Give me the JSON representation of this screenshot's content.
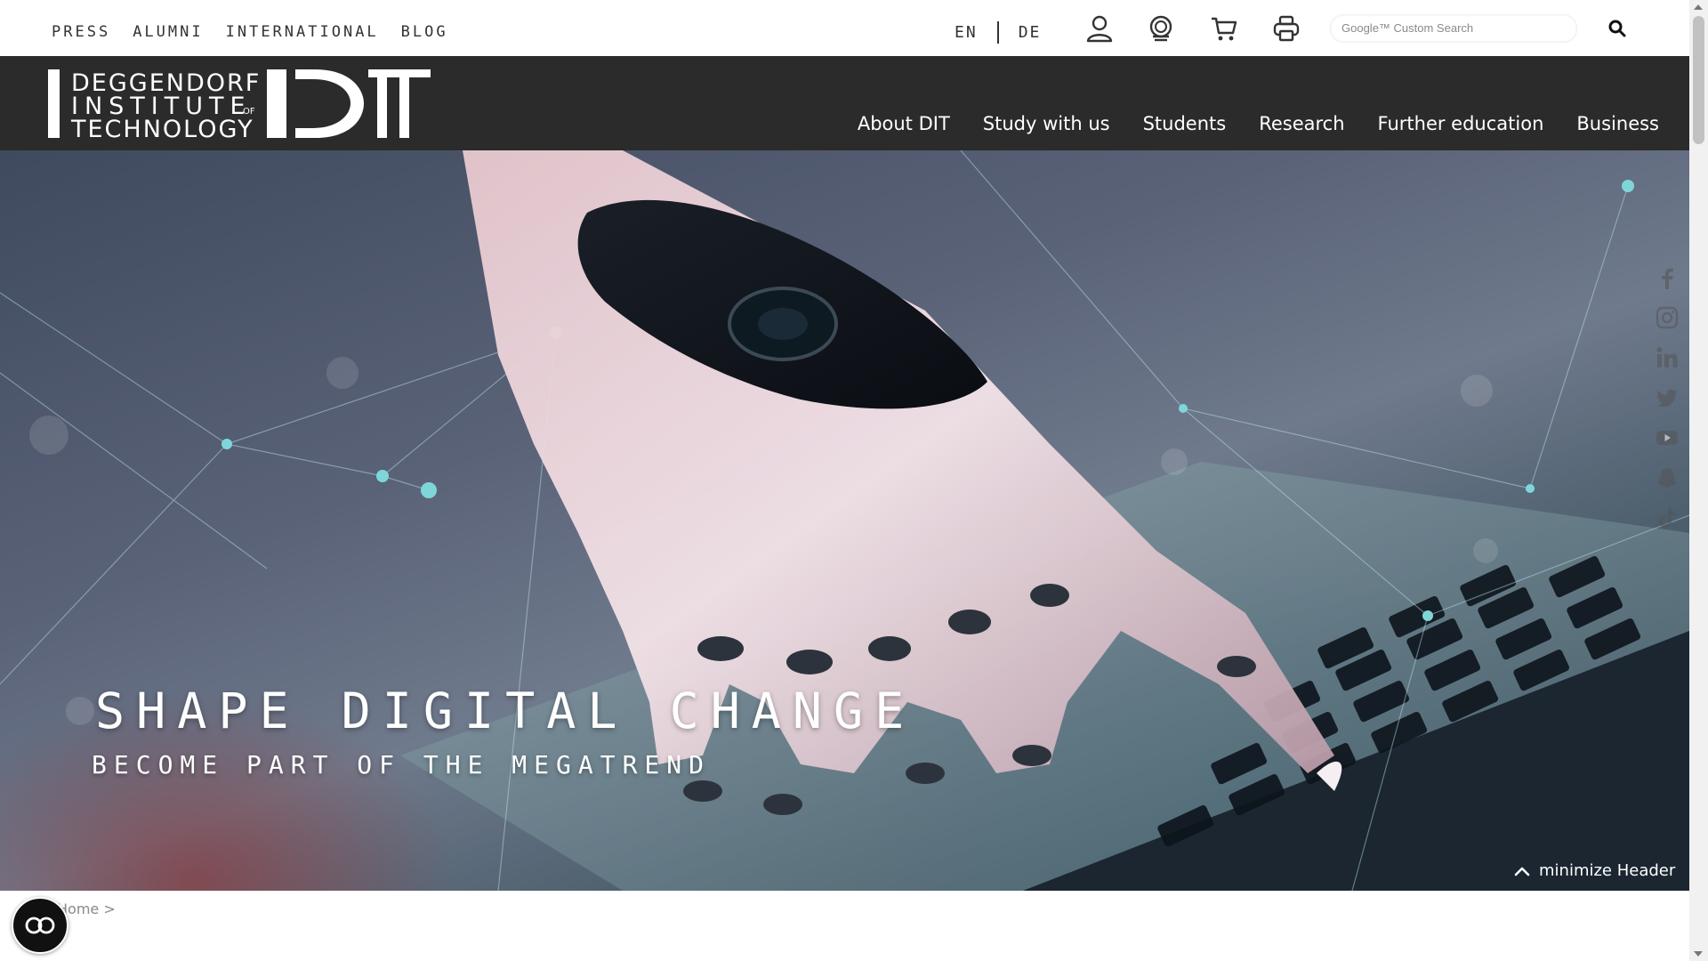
{
  "top_links": [
    "PRESS",
    "ALUMNI",
    "INTERNATIONAL",
    "BLOG"
  ],
  "language": {
    "en": "EN",
    "de": "DE"
  },
  "toolbar_icons": [
    "user-icon",
    "award-icon",
    "cart-icon",
    "printer-icon"
  ],
  "search": {
    "placeholder": "Google™ Custom Search",
    "button_icon": "search-icon"
  },
  "logo": {
    "line1": "DEGGENDORF",
    "line2": "INSTITUTE",
    "of": "OF",
    "line3": "TECHNOLOGY",
    "mark": "DIT"
  },
  "main_nav": [
    "About DIT",
    "Study with us",
    "Students",
    "Research",
    "Further education",
    "Business"
  ],
  "hero": {
    "title": "SHAPE DIGITAL CHANGE",
    "subtitle": "BECOME PART OF THE MEGATREND"
  },
  "minimize_label": "minimize Header",
  "social_icons": [
    "facebook-icon",
    "instagram-icon",
    "linkedin-icon",
    "twitter-icon",
    "youtube-icon",
    "snapchat-icon",
    "tiktok-icon"
  ],
  "breadcrumb": "Home >",
  "colors": {
    "nav_bg": "#2b2b2b",
    "text_dark": "#333333",
    "white": "#ffffff"
  }
}
